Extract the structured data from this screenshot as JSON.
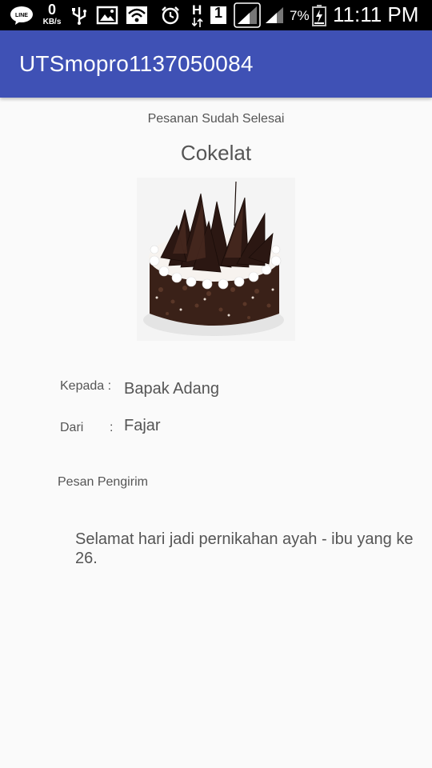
{
  "status_bar": {
    "net_speed_value": "0",
    "net_speed_unit": "KB/s",
    "sim_h_label": "H",
    "sim_1_label": "1",
    "battery_percent": "7%",
    "time": "11:11 PM",
    "line_app_label": "LINE"
  },
  "app_bar": {
    "title": "UTSmopro1137050084"
  },
  "order": {
    "status_message": "Pesanan Sudah Selesai",
    "cake_name": "Cokelat",
    "to_label": "Kepada :",
    "to_value": "Bapak Adang",
    "from_label": "Dari",
    "from_colon": ":",
    "from_value": "Fajar",
    "sender_message_label": "Pesan Pengirim",
    "sender_message": "Selamat hari jadi pernikahan ayah - ibu yang ke 26."
  },
  "colors": {
    "app_bar": "#3f51b5",
    "status_bar": "#000000",
    "text": "#555555"
  }
}
